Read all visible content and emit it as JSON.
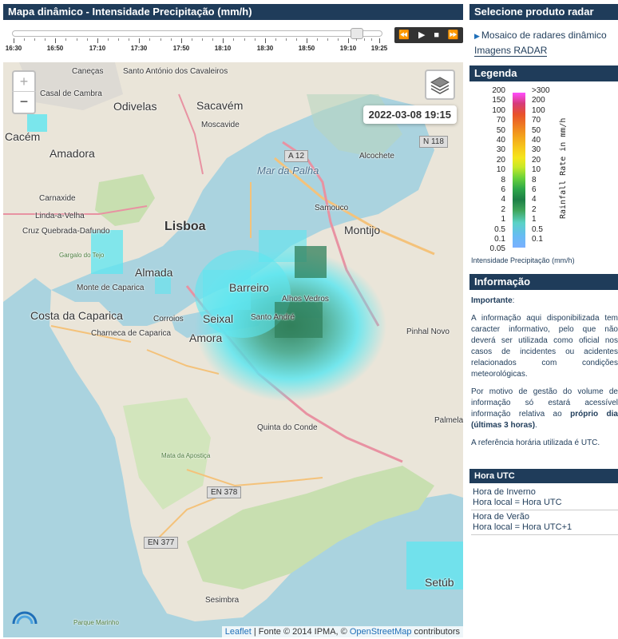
{
  "left_header": "Mapa dinâmico - Intensidade Precipitação (mm/h)",
  "timeline": {
    "ticks": [
      "16:30",
      "16:50",
      "17:10",
      "17:30",
      "17:50",
      "18:10",
      "18:30",
      "18:50",
      "19:10",
      "19:25"
    ],
    "position": 0.947
  },
  "playback": {
    "rewind": "⏪",
    "play": "▶",
    "stop": "■",
    "forward": "⏩"
  },
  "right_header": "Selecione produto radar",
  "products": {
    "active": "Mosaico de radares dinâmico",
    "other": "Imagens RADAR"
  },
  "legend": {
    "header": "Legenda",
    "left_values": [
      "200",
      "150",
      "100",
      "70",
      "50",
      "40",
      "30",
      "20",
      "10",
      "8",
      "6",
      "4",
      "2",
      "1",
      "0.5",
      "0.1",
      "0.05"
    ],
    "right_values": [
      ">300",
      "200",
      "100",
      "70",
      "50",
      "40",
      "30",
      "20",
      "10",
      "8",
      "6",
      "4",
      "2",
      "1",
      "0.5",
      "0.1"
    ],
    "axis_label": "Rainfall Rate in mm/h",
    "caption": "Intensidade Precipitação (mm/h)"
  },
  "info": {
    "header": "Informação",
    "important_label": "Importante",
    "p1": "A informação aqui disponibilizada tem caracter informativo, pelo que não deverá ser utilizada como oficial nos casos de incidentes ou acidentes relacionados com condições meteorológicas.",
    "p2_start": "Por motivo de gestão do volume de informação só estará acessível informação relativa ao ",
    "p2_bold": "próprio dia (últimas 3 horas)",
    "p2_end": ".",
    "p3": "A referência horária utilizada é UTC."
  },
  "utc": {
    "header": "Hora UTC",
    "rows": [
      {
        "title": "Hora de Inverno",
        "value": "Hora local = Hora UTC"
      },
      {
        "title": "Hora de Verão",
        "value": "Hora local = Hora UTC+1"
      }
    ]
  },
  "map": {
    "zoom_in": "+",
    "zoom_out": "−",
    "timestamp": "2022-03-08 19:15",
    "attribution_leaflet": "Leaflet",
    "attribution_mid": " | Fonte © 2014 IPMA, © ",
    "attribution_osm": "OpenStreetMap",
    "attribution_end": " contributors",
    "places": [
      {
        "name": "Caneças",
        "size": "s"
      },
      {
        "name": "Santo António dos Cavaleiros",
        "size": "s"
      },
      {
        "name": "Casal de Cambra",
        "size": "s"
      },
      {
        "name": "Odivelas",
        "size": "m"
      },
      {
        "name": "Sacavém",
        "size": "m"
      },
      {
        "name": "Moscavide",
        "size": "s"
      },
      {
        "name": "Cacém",
        "size": "m"
      },
      {
        "name": "Amadora",
        "size": "m"
      },
      {
        "name": "Mar da Palha",
        "size": "water"
      },
      {
        "name": "Alcochete",
        "size": "s"
      },
      {
        "name": "Carnaxide",
        "size": "s"
      },
      {
        "name": "Linda-a-Velha",
        "size": "s"
      },
      {
        "name": "Cruz Quebrada-Dafundo",
        "size": "s"
      },
      {
        "name": "Lisboa",
        "size": "l"
      },
      {
        "name": "Samouco",
        "size": "s"
      },
      {
        "name": "Montijo",
        "size": "m"
      },
      {
        "name": "Almada",
        "size": "m"
      },
      {
        "name": "Monte de Caparica",
        "size": "s"
      },
      {
        "name": "Barreiro",
        "size": "m"
      },
      {
        "name": "Alhos Vedros",
        "size": "s"
      },
      {
        "name": "Costa da Caparica",
        "size": "m"
      },
      {
        "name": "Seixal",
        "size": "m"
      },
      {
        "name": "Corroios",
        "size": "s"
      },
      {
        "name": "Santo André",
        "size": "s"
      },
      {
        "name": "Pinhal Novo",
        "size": "s"
      },
      {
        "name": "Charneca de Caparica",
        "size": "s"
      },
      {
        "name": "Amora",
        "size": "m"
      },
      {
        "name": "Quinta do Conde",
        "size": "s"
      },
      {
        "name": "Palmela",
        "size": "s"
      },
      {
        "name": "Mata da Apostiça",
        "size": "xs"
      },
      {
        "name": "Setúb",
        "size": "m"
      },
      {
        "name": "Sesimbra",
        "size": "s"
      },
      {
        "name": "Parque Marinho",
        "size": "xs"
      },
      {
        "name": "Gargalo do Tejo",
        "size": "xs"
      }
    ],
    "roads": [
      "A 12",
      "N 118",
      "EN 378",
      "EN 377"
    ],
    "colors": {
      "water": "#aad3df",
      "land": "#eae5d9",
      "green": "#c8dfb0",
      "radar_light": "#5ee6f0",
      "radar_dark": "#2f7f5a"
    }
  }
}
